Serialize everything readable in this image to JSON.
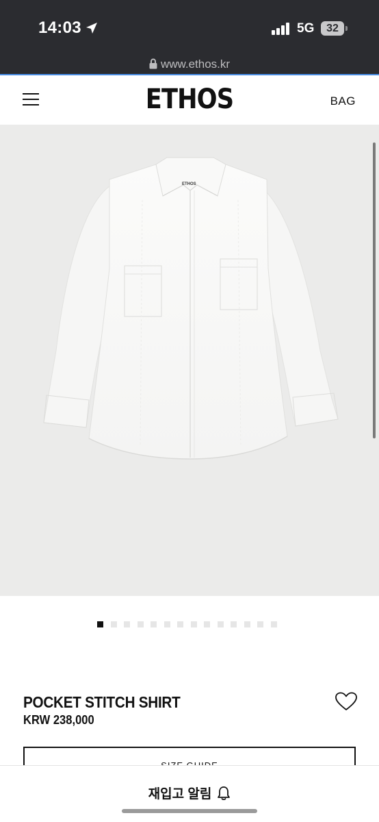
{
  "status_bar": {
    "time": "14:03",
    "network": "5G",
    "battery": "32",
    "icons": [
      "location-arrow-icon",
      "signal-icon",
      "battery-icon"
    ]
  },
  "browser": {
    "url": "www.ethos.kr",
    "icon": "lock-icon"
  },
  "header": {
    "logo": "ETHOS",
    "bag_label": "BAG",
    "menu_icon": "hamburger-menu-icon"
  },
  "carousel": {
    "total_images": 14,
    "active_index": 0
  },
  "product": {
    "name": "POCKET STITCH SHIRT",
    "price": "KRW 238,000",
    "collar_label": "ETHOS",
    "size_guide_label": "SIZE GUIDE",
    "wishlist_icon": "heart-outline-icon"
  },
  "bottom_bar": {
    "restock_label": "재입고 알림",
    "icon": "bell-icon"
  },
  "colors": {
    "status_bg": "#2b2c30",
    "accent": "#4a8fe7",
    "image_bg": "#ebebea",
    "text": "#111111"
  }
}
